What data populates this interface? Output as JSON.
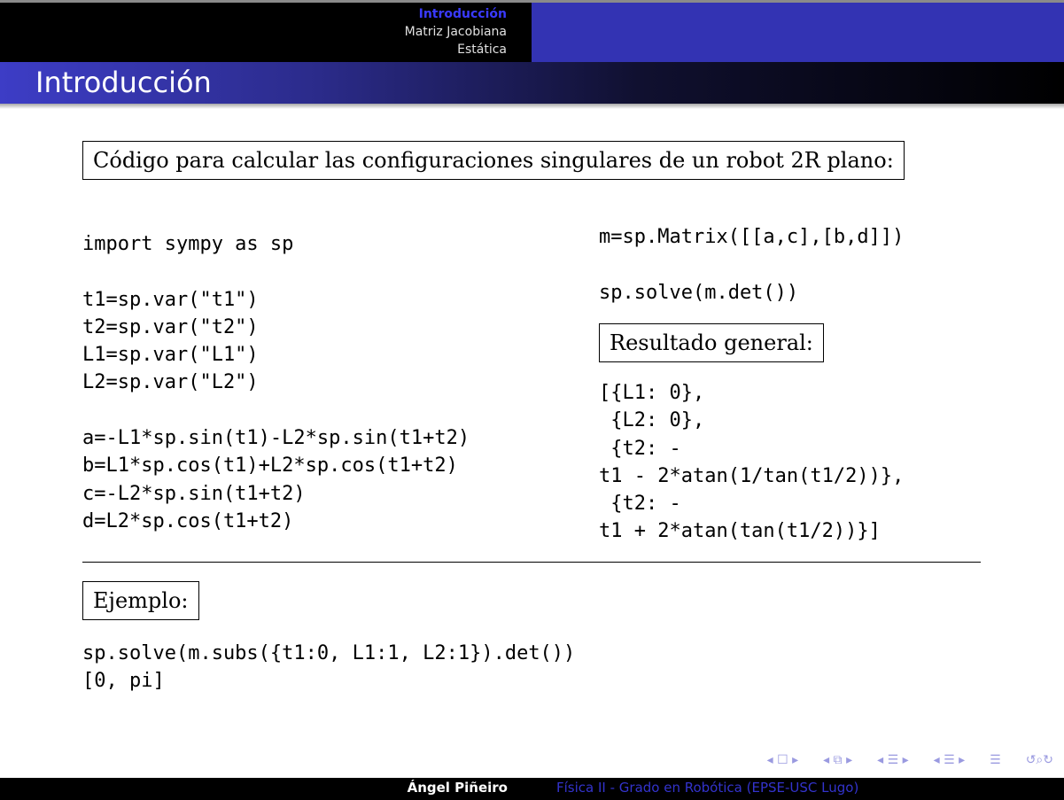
{
  "header": {
    "nav_sections": [
      {
        "label": "Introducción",
        "active": true
      },
      {
        "label": "Matriz Jacobiana",
        "active": false
      },
      {
        "label": "Estática",
        "active": false
      }
    ]
  },
  "slide": {
    "title": "Introducción",
    "intro_box": "Código para calcular las configuraciones singulares de un robot 2R plano:",
    "left_code": [
      "import sympy as sp",
      "",
      "t1=sp.var(\"t1\")",
      "t2=sp.var(\"t2\")",
      "L1=sp.var(\"L1\")",
      "L2=sp.var(\"L2\")",
      "",
      "a=-L1*sp.sin(t1)-L2*sp.sin(t1+t2)",
      "b=L1*sp.cos(t1)+L2*sp.cos(t1+t2)",
      "c=-L2*sp.sin(t1+t2)",
      "d=L2*sp.cos(t1+t2)"
    ],
    "right_code": [
      "m=sp.Matrix([[a,c],[b,d]])",
      "",
      "sp.solve(m.det())"
    ],
    "result_box": "Resultado general:",
    "result_code": [
      "[{L1: 0},",
      " {L2: 0},",
      " {t2: -",
      "t1 - 2*atan(1/tan(t1/2))},",
      " {t2: -",
      "t1 + 2*atan(tan(t1/2))}]"
    ],
    "example_box": "Ejemplo:",
    "example_code": [
      "sp.solve(m.subs({t1:0, L1:1, L2:1}).det())",
      "[0, pi]"
    ]
  },
  "footer": {
    "author": "Ángel Piñeiro",
    "course": "Física II - Grado en Robótica (EPSE-USC Lugo)"
  },
  "beamer_nav_icons": [
    "nav-first-icon",
    "nav-frame-icon",
    "nav-subsection-icon",
    "nav-section-icon",
    "nav-doc-icon",
    "nav-search-icon"
  ],
  "colors": {
    "header_blue": "#3333b3",
    "active_nav": "#3a3aff",
    "footer_course": "#3333cc"
  }
}
